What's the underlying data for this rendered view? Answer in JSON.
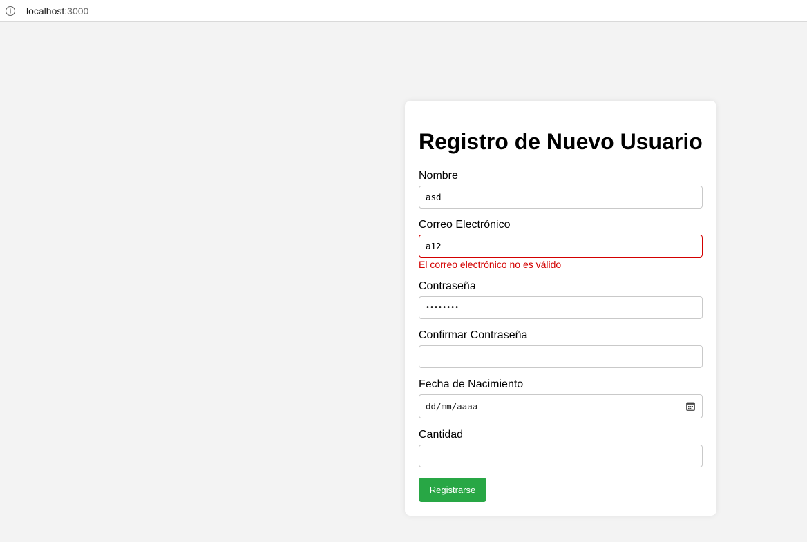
{
  "browser": {
    "url_host": "localhost",
    "url_port": ":3000",
    "info_icon": "info-icon"
  },
  "form": {
    "title": "Registro de Nuevo Usuario",
    "fields": {
      "name": {
        "label": "Nombre",
        "value": "asd"
      },
      "email": {
        "label": "Correo Electrónico",
        "value": "a12",
        "error": "El correo electrónico no es válido",
        "error_color": "#d30000"
      },
      "password": {
        "label": "Contraseña",
        "value": "••••••••"
      },
      "confirm_password": {
        "label": "Confirmar Contraseña",
        "value": ""
      },
      "birthdate": {
        "label": "Fecha de Nacimiento",
        "placeholder": "dd/mm/aaaa",
        "icon": "calendar-icon"
      },
      "quantity": {
        "label": "Cantidad",
        "value": ""
      }
    },
    "submit_label": "Registrarse",
    "submit_color": "#28a745"
  }
}
